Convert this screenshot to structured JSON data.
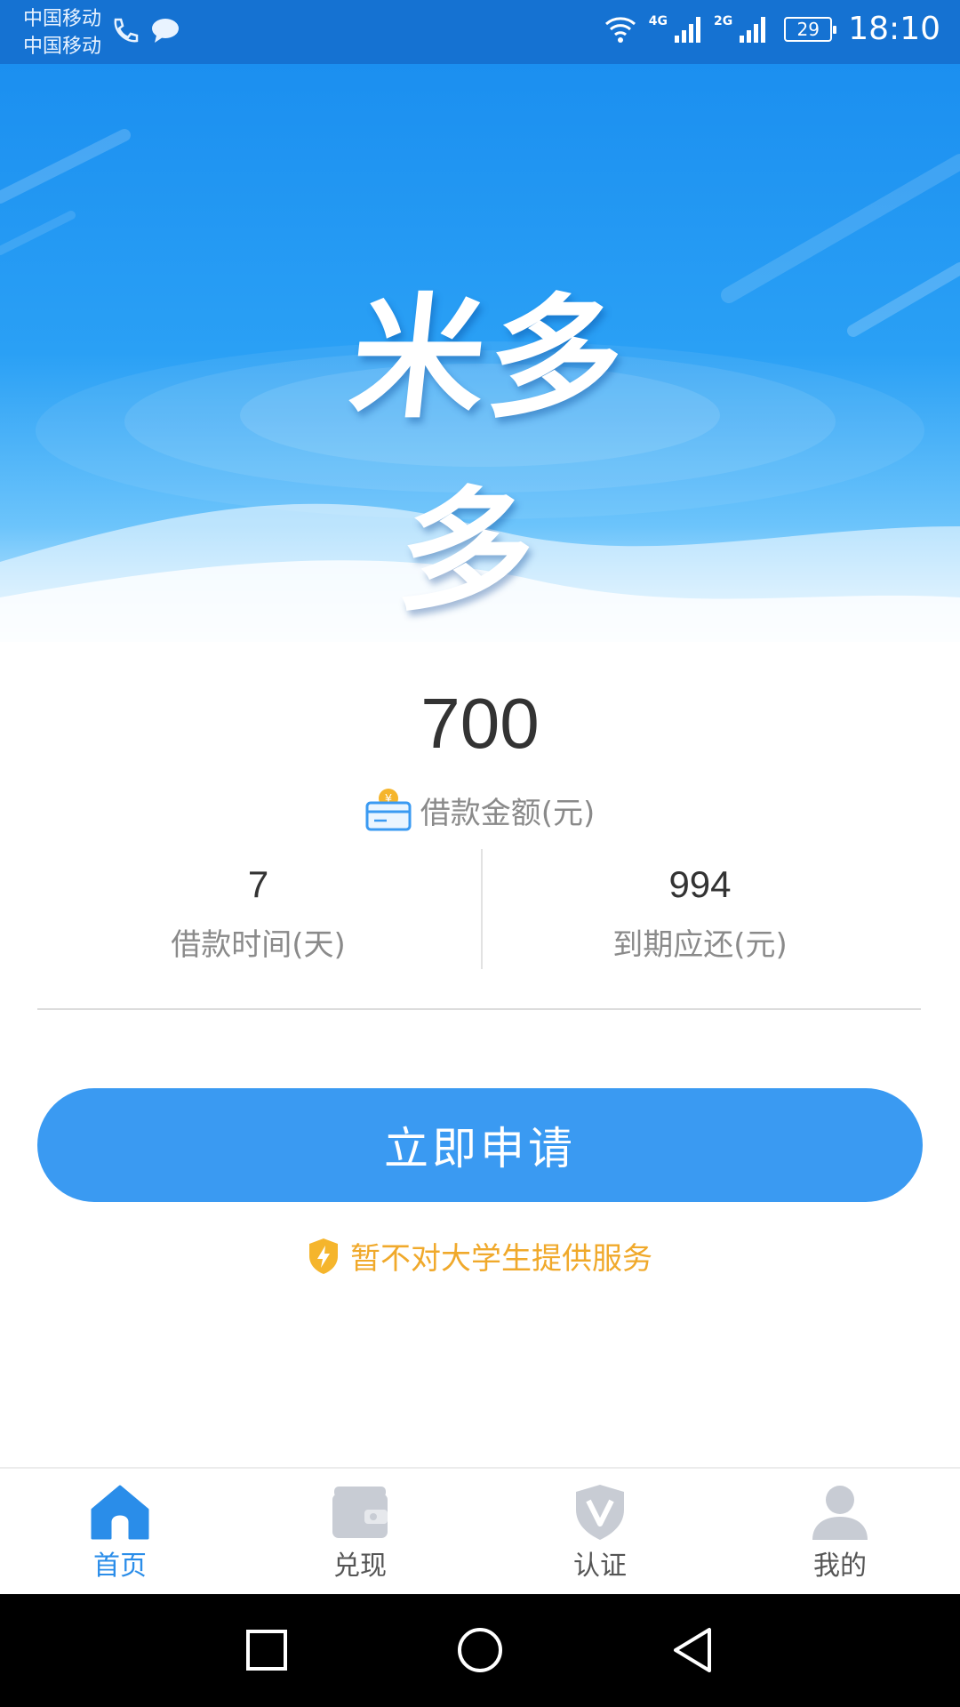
{
  "status_bar": {
    "carrier_1": "中国移动",
    "carrier_2": "中国移动",
    "network_1": "4G",
    "network_2": "2G",
    "battery": "29",
    "time": "18:10"
  },
  "hero": {
    "logo_text": "米多多"
  },
  "loan": {
    "amount": "700",
    "amount_label": "借款金额(元)",
    "term_value": "7",
    "term_label": "借款时间(天)",
    "repay_value": "994",
    "repay_label": "到期应还(元)"
  },
  "apply_button": "立即申请",
  "notice": "暂不对大学生提供服务",
  "tabs": [
    {
      "label": "首页",
      "icon": "home-icon",
      "active": true
    },
    {
      "label": "兑现",
      "icon": "wallet-icon",
      "active": false
    },
    {
      "label": "认证",
      "icon": "shield-v-icon",
      "active": false
    },
    {
      "label": "我的",
      "icon": "user-icon",
      "active": false
    }
  ],
  "colors": {
    "primary": "#3a9af2",
    "status_bar": "#1572d2",
    "notice": "#f0a92b",
    "active_tab": "#2a8de9"
  }
}
